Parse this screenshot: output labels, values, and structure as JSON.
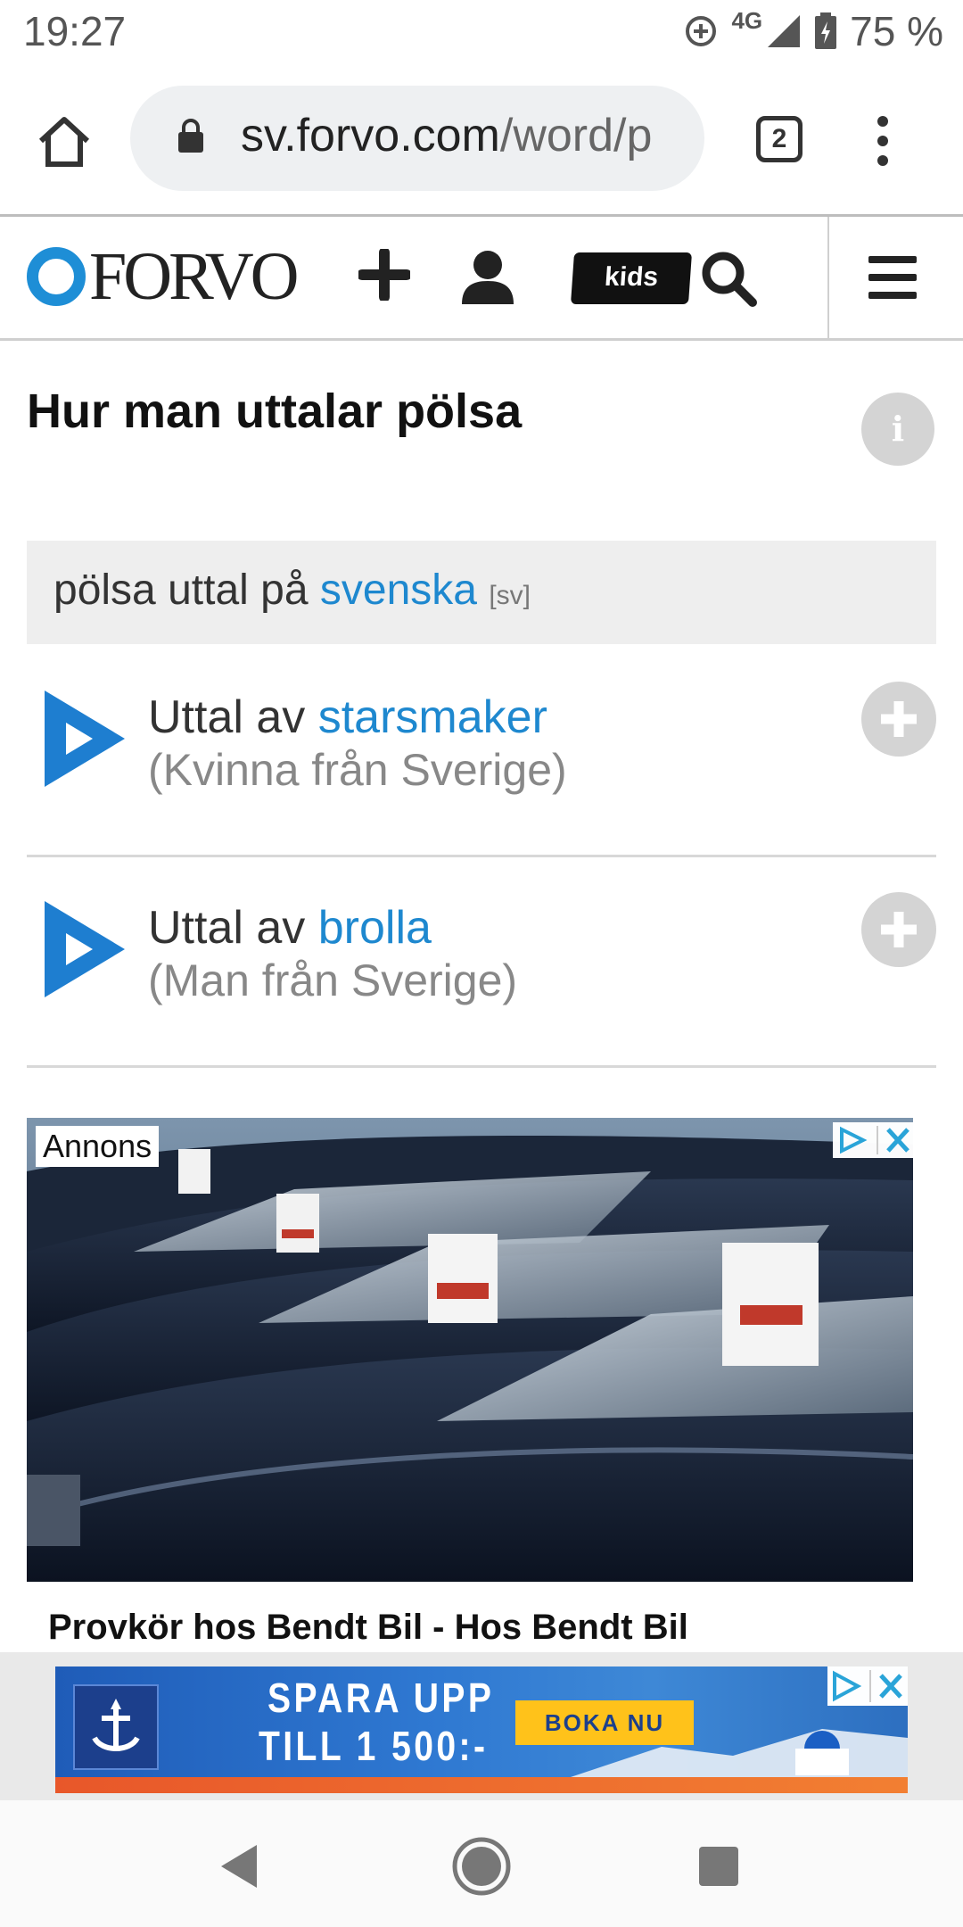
{
  "status_bar": {
    "time": "19:27",
    "network": "4G",
    "battery": "75 %"
  },
  "browser": {
    "url_host": "sv.forvo.com",
    "url_path": "/word/p",
    "tab_count": "2"
  },
  "forvo_header": {
    "logo_text": "FORVO",
    "kids_label": "kids"
  },
  "page": {
    "title": "Hur man uttalar pölsa",
    "info_label": "i",
    "language_bar": {
      "prefix": "pölsa uttal på ",
      "language": "svenska",
      "code": "[sv]"
    },
    "pronunciations": [
      {
        "prefix": "Uttal av ",
        "user": "starsmaker",
        "detail": "(Kvinna från Sverige)"
      },
      {
        "prefix": "Uttal av ",
        "user": "brolla",
        "detail": "(Man från Sverige)"
      }
    ]
  },
  "ad": {
    "label": "Annons",
    "title": "Provkör hos Bendt Bil - Hos Bendt Bil"
  },
  "banner": {
    "line1": "SPARA UPP",
    "line2": "TILL 1 500:-",
    "cta": "BOKA NU"
  },
  "colors": {
    "accent": "#1e88cf",
    "play_blue": "#1e7ed0",
    "grey_button": "#d4d4d4"
  }
}
